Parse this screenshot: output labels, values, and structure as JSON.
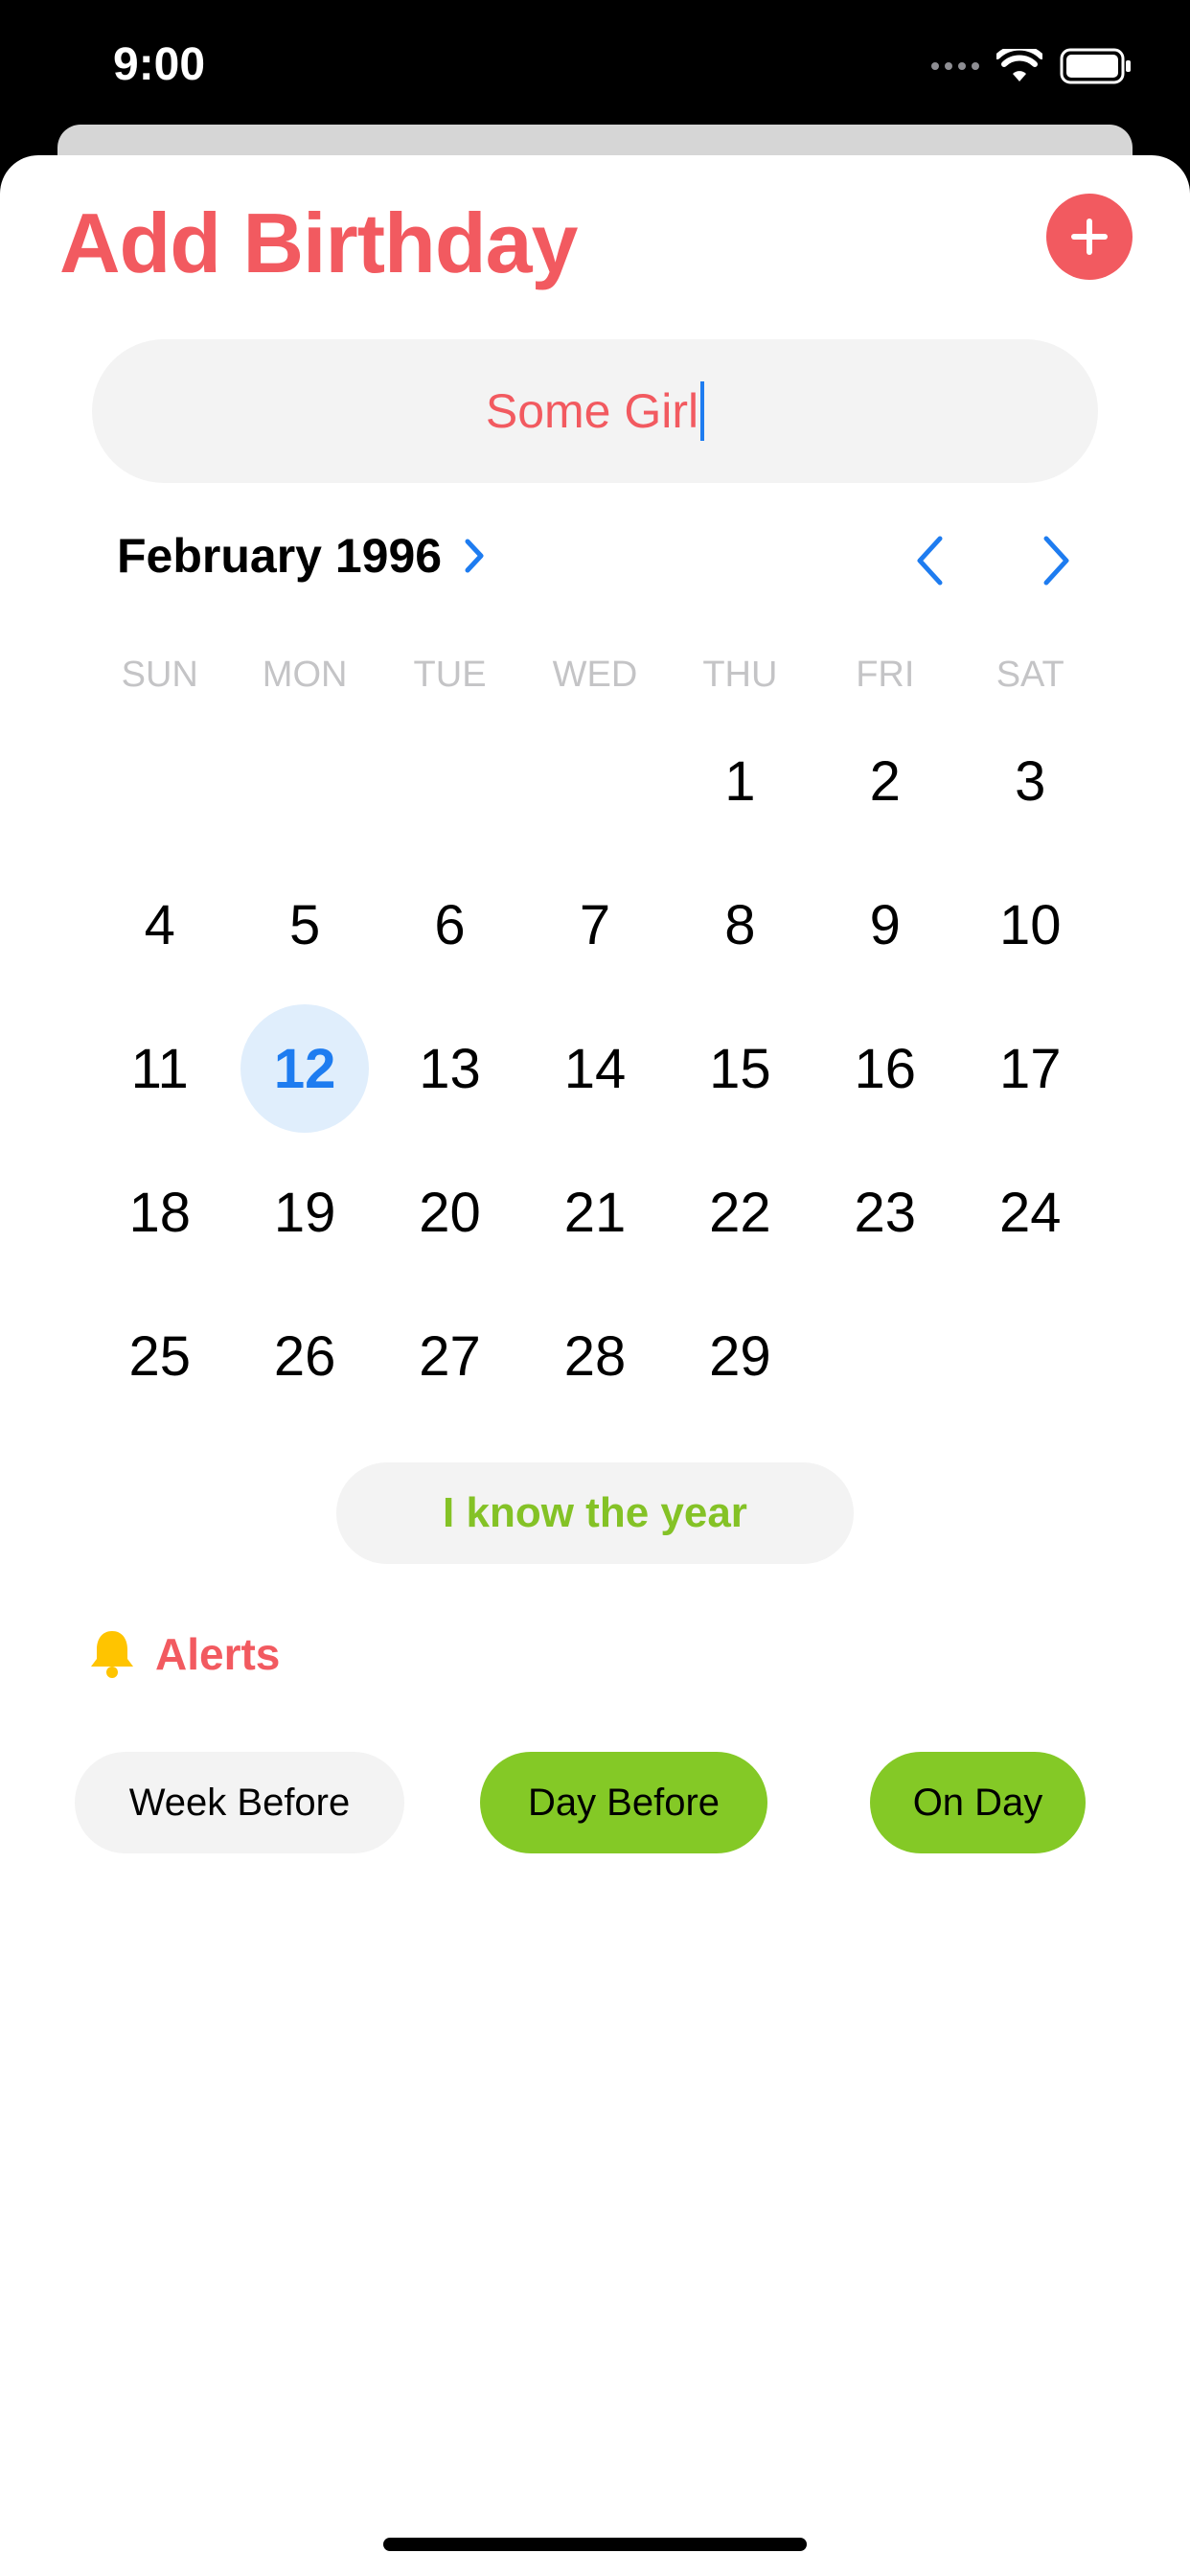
{
  "status_bar": {
    "time": "9:00"
  },
  "header": {
    "title": "Add Birthday",
    "add_icon": "plus-circle-icon"
  },
  "name_field": {
    "value": "Some Girl"
  },
  "calendar": {
    "month_label": "February 1996",
    "weekdays": [
      "SUN",
      "MON",
      "TUE",
      "WED",
      "THU",
      "FRI",
      "SAT"
    ],
    "days": [
      "",
      "",
      "",
      "",
      "1",
      "2",
      "3",
      "4",
      "5",
      "6",
      "7",
      "8",
      "9",
      "10",
      "11",
      "12",
      "13",
      "14",
      "15",
      "16",
      "17",
      "18",
      "19",
      "20",
      "21",
      "22",
      "23",
      "24",
      "25",
      "26",
      "27",
      "28",
      "29",
      "",
      ""
    ],
    "selected_day": "12"
  },
  "year_toggle": {
    "label": "I know the year"
  },
  "alerts": {
    "label": "Alerts",
    "icon": "bell-icon",
    "options": [
      {
        "label": "Week Before",
        "active": false
      },
      {
        "label": "Day Before",
        "active": true
      },
      {
        "label": "On Day",
        "active": true
      }
    ]
  },
  "colors": {
    "accent_red": "#f25a60",
    "accent_green": "#84c926",
    "accent_blue": "#1e7cf0",
    "bell_yellow": "#ffc400"
  }
}
